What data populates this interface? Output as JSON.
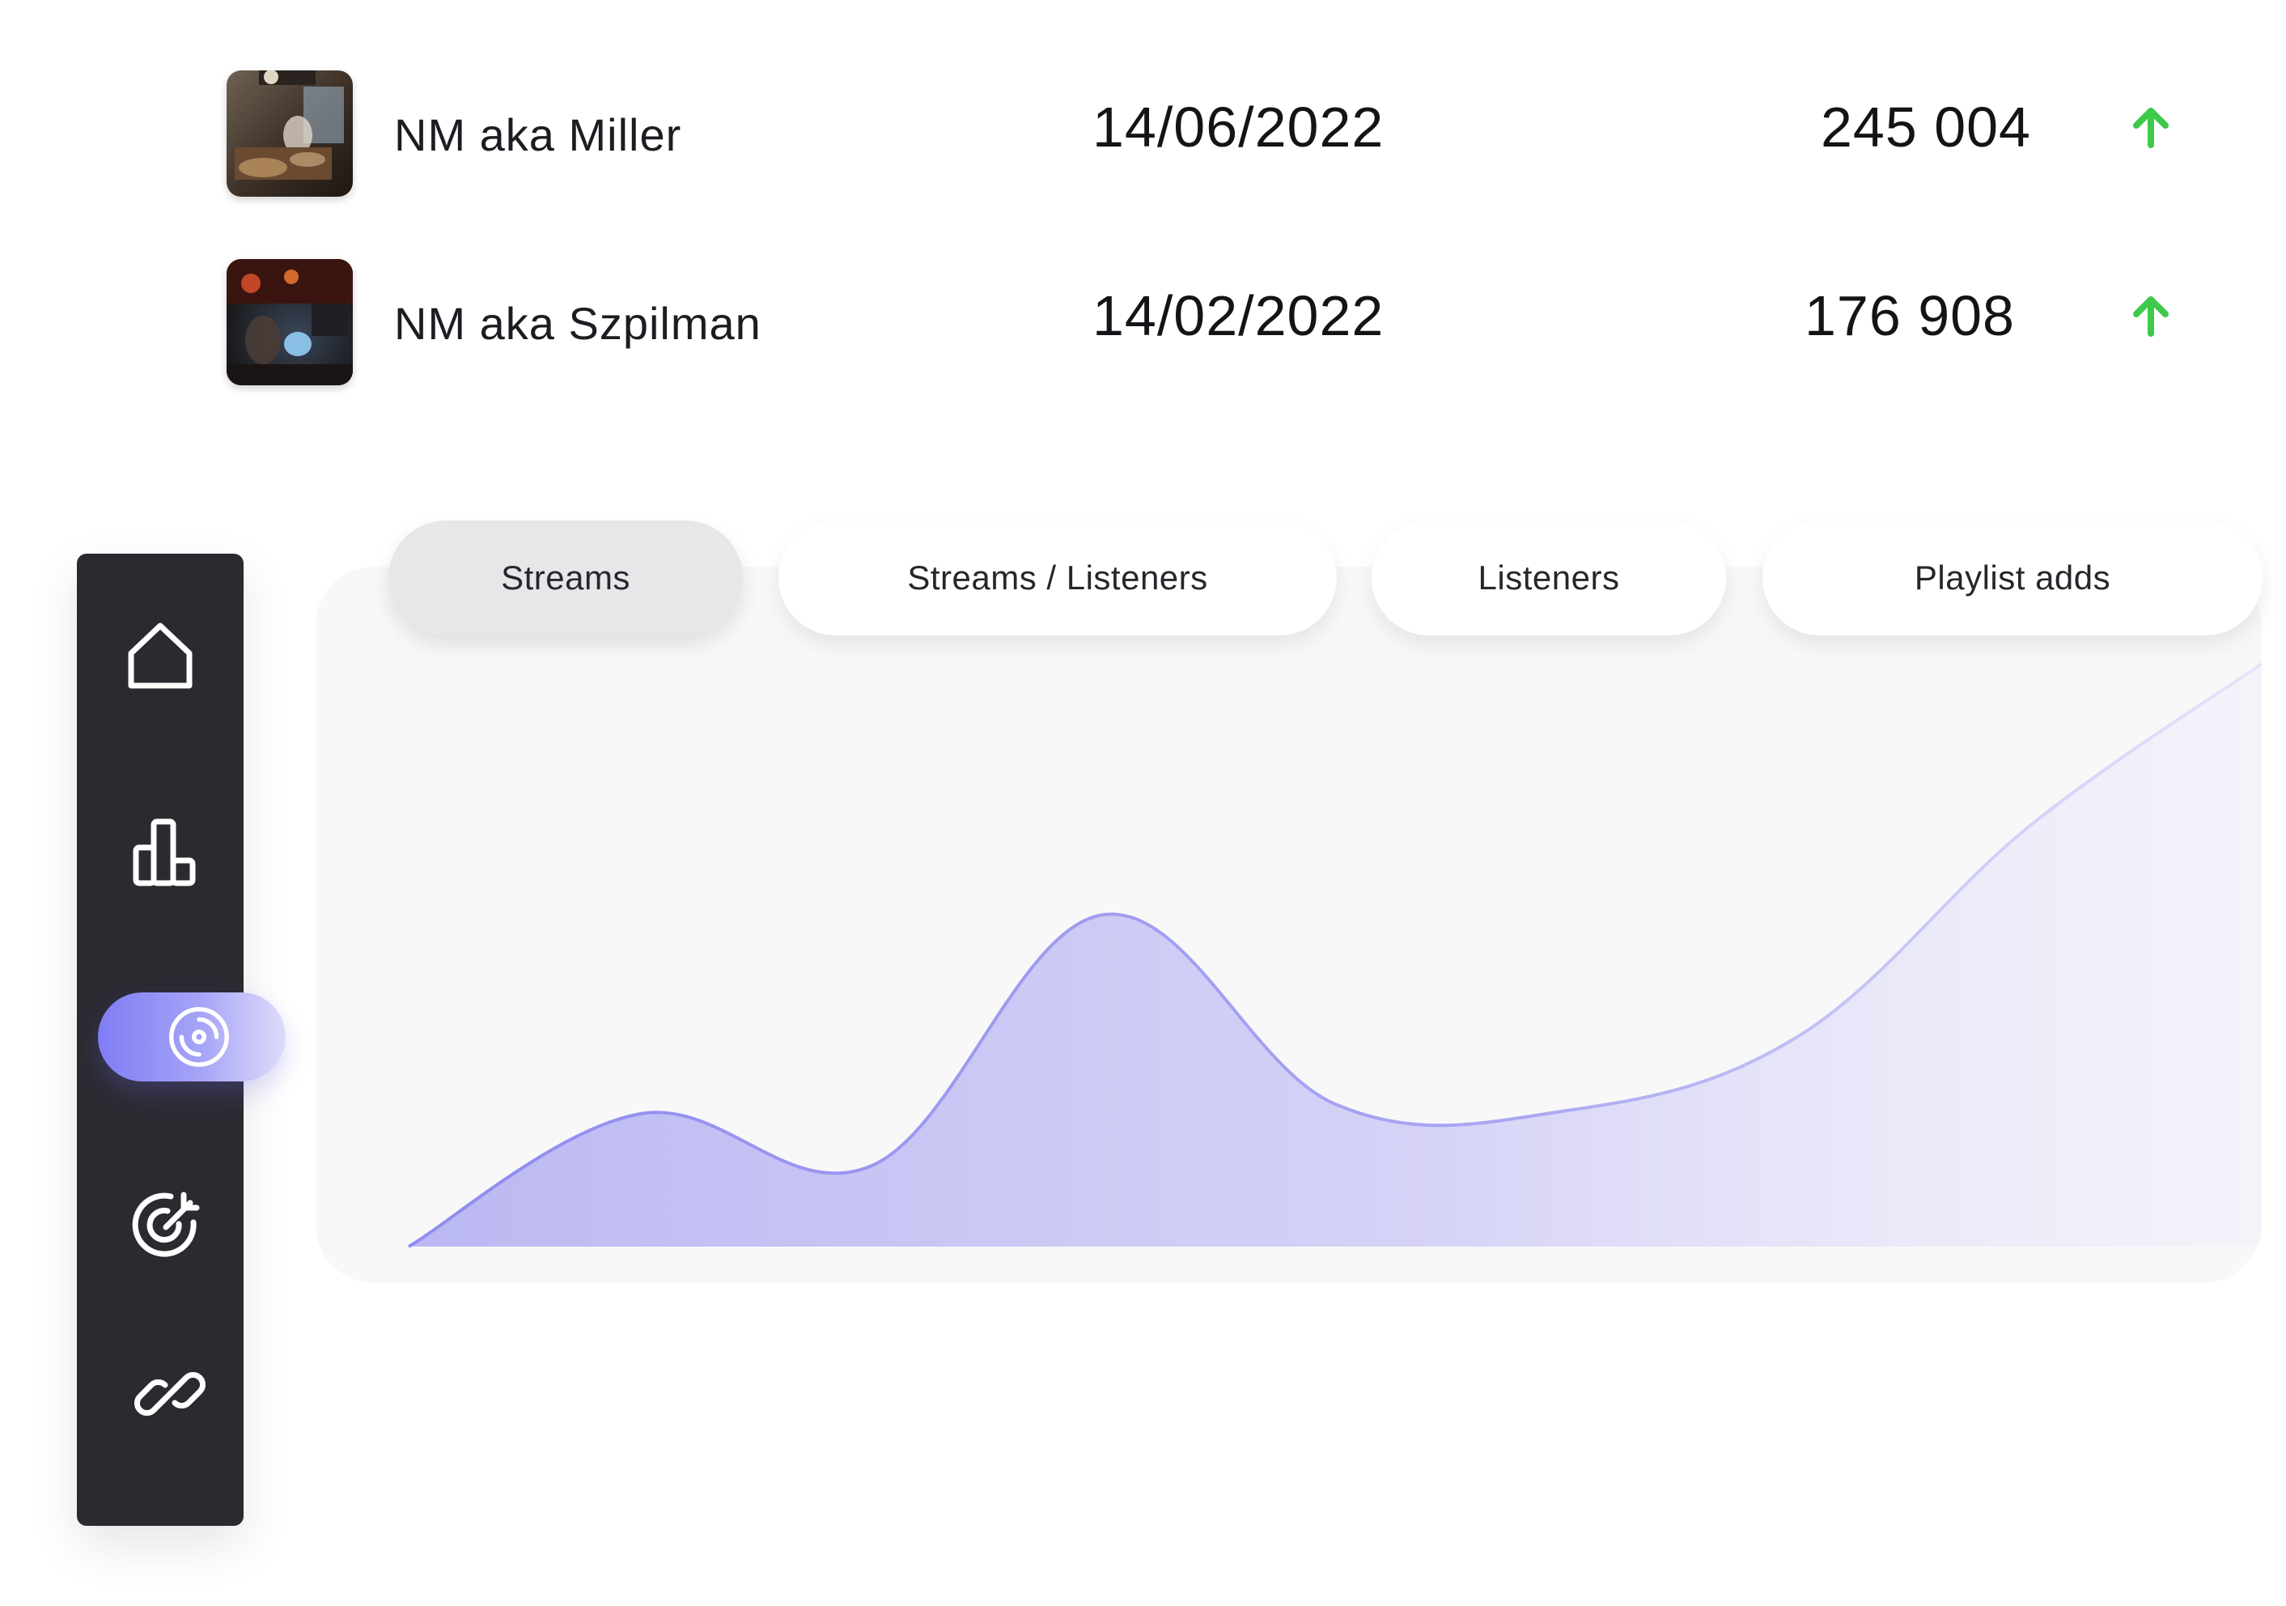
{
  "releases": [
    {
      "title": "NM aka Miller",
      "date": "14/06/2022",
      "count": "245 004",
      "trend": "up-arrow-icon"
    },
    {
      "title": "NM aka Szpilman",
      "date": "14/02/2022",
      "count": "176 908",
      "trend": "up-arrow-icon"
    }
  ],
  "tabs": [
    {
      "label": "Streams",
      "active": true
    },
    {
      "label": "Streams / Listeners",
      "active": false
    },
    {
      "label": "Listeners",
      "active": false
    },
    {
      "label": "Playlist adds",
      "active": false
    }
  ],
  "sidebar": {
    "items": [
      {
        "icon": "home-icon",
        "active": false
      },
      {
        "icon": "bar-chart-icon",
        "active": false
      },
      {
        "icon": "disc-icon",
        "active": true
      },
      {
        "icon": "target-icon",
        "active": false
      },
      {
        "icon": "link-icon",
        "active": false
      }
    ]
  },
  "colors": {
    "accent": "#8583f3",
    "accent_light": "#c9c7f7",
    "trend_up": "#3ec94a",
    "sidebar_bg": "#2b2a31",
    "panel_bg": "#f8f8f9"
  },
  "chart_data": {
    "type": "area",
    "x": [
      0,
      1,
      2,
      3,
      4,
      5,
      6,
      7,
      8
    ],
    "values": [
      0,
      0.82,
      0.5,
      2.05,
      0.88,
      0.84,
      1.3,
      2.6,
      3.6
    ],
    "title": "",
    "xlabel": "",
    "ylabel": "",
    "ylim": [
      0,
      3.6
    ],
    "grid": false,
    "legend": "none"
  }
}
